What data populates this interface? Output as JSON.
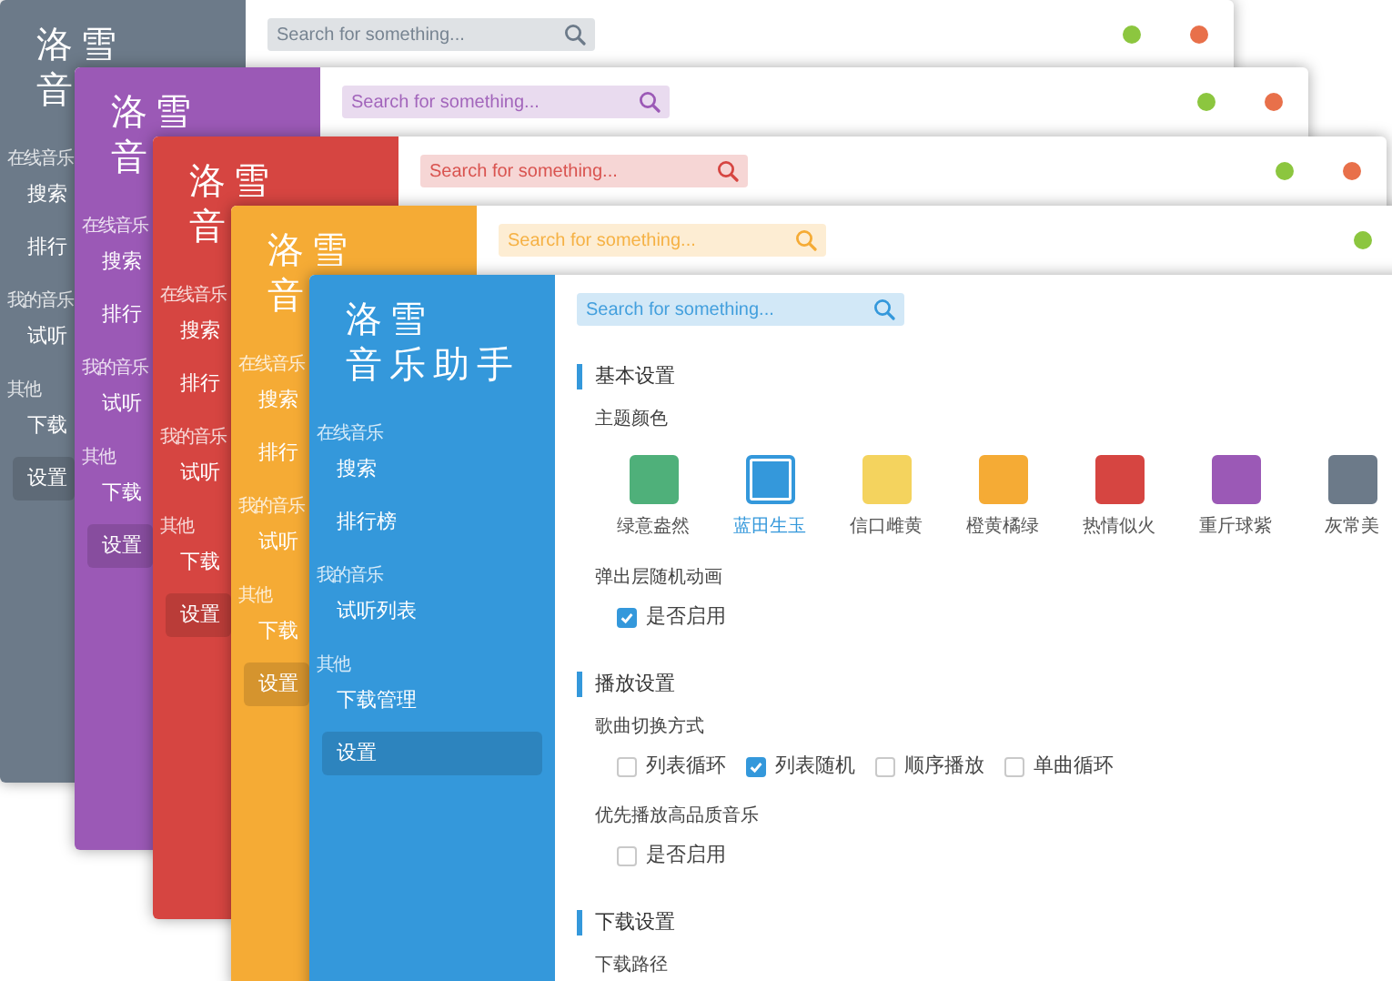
{
  "windows": [
    {
      "color": "#6c7a89",
      "logo": [
        "洛雪",
        "音"
      ],
      "search": {
        "placeholder": "Search for something..."
      },
      "dots": [
        {
          "color": "#8cc63f"
        },
        {
          "color": "#e8704a"
        }
      ],
      "nav": [
        {
          "kind": "label",
          "text": "在线音乐"
        },
        {
          "kind": "item",
          "text": "搜索",
          "selected": false
        },
        {
          "kind": "item",
          "text": "排行",
          "selected": false
        },
        {
          "kind": "label",
          "text": "我的音乐"
        },
        {
          "kind": "item",
          "text": "试听",
          "selected": false
        },
        {
          "kind": "label",
          "text": "其他"
        },
        {
          "kind": "item",
          "text": "下载",
          "selected": false
        },
        {
          "kind": "item",
          "text": "设置",
          "selected": true
        }
      ]
    },
    {
      "color": "#9b59b6",
      "logo": [
        "洛雪",
        "音"
      ],
      "search": {
        "placeholder": "Search for something..."
      },
      "dots": [
        {
          "color": "#8cc63f"
        },
        {
          "color": "#e8704a"
        }
      ],
      "nav": [
        {
          "kind": "label",
          "text": "在线音乐"
        },
        {
          "kind": "item",
          "text": "搜索",
          "selected": false
        },
        {
          "kind": "item",
          "text": "排行",
          "selected": false
        },
        {
          "kind": "label",
          "text": "我的音乐"
        },
        {
          "kind": "item",
          "text": "试听",
          "selected": false
        },
        {
          "kind": "label",
          "text": "其他"
        },
        {
          "kind": "item",
          "text": "下载",
          "selected": false
        },
        {
          "kind": "item",
          "text": "设置",
          "selected": true
        }
      ]
    },
    {
      "color": "#d64541",
      "logo": [
        "洛雪",
        "音"
      ],
      "search": {
        "placeholder": "Search for something..."
      },
      "dots": [
        {
          "color": "#8cc63f"
        },
        {
          "color": "#e8704a"
        }
      ],
      "nav": [
        {
          "kind": "label",
          "text": "在线音乐"
        },
        {
          "kind": "item",
          "text": "搜索",
          "selected": false
        },
        {
          "kind": "item",
          "text": "排行",
          "selected": false
        },
        {
          "kind": "label",
          "text": "我的音乐"
        },
        {
          "kind": "item",
          "text": "试听",
          "selected": false
        },
        {
          "kind": "label",
          "text": "其他"
        },
        {
          "kind": "item",
          "text": "下载",
          "selected": false
        },
        {
          "kind": "item",
          "text": "设置",
          "selected": true
        }
      ]
    },
    {
      "color": "#f5ab35",
      "logo": [
        "洛雪",
        "音"
      ],
      "search": {
        "placeholder": "Search for something..."
      },
      "dots": [
        {
          "color": "#8cc63f"
        }
      ],
      "nav": [
        {
          "kind": "label",
          "text": "在线音乐"
        },
        {
          "kind": "item",
          "text": "搜索",
          "selected": false
        },
        {
          "kind": "item",
          "text": "排行",
          "selected": false
        },
        {
          "kind": "label",
          "text": "我的音乐"
        },
        {
          "kind": "item",
          "text": "试听",
          "selected": false
        },
        {
          "kind": "label",
          "text": "其他"
        },
        {
          "kind": "item",
          "text": "下载",
          "selected": false
        },
        {
          "kind": "item",
          "text": "设置",
          "selected": true
        }
      ]
    },
    {
      "color": "#3498db",
      "logo": [
        "洛雪",
        "音乐助手"
      ],
      "search": {
        "placeholder": "Search for something..."
      },
      "nav": [
        {
          "kind": "label",
          "text": "在线音乐"
        },
        {
          "kind": "item",
          "text": "搜索",
          "selected": false
        },
        {
          "kind": "item",
          "text": "排行榜",
          "selected": false
        },
        {
          "kind": "label",
          "text": "我的音乐"
        },
        {
          "kind": "item",
          "text": "试听列表",
          "selected": false
        },
        {
          "kind": "label",
          "text": "其他"
        },
        {
          "kind": "item",
          "text": "下载管理",
          "selected": false
        },
        {
          "kind": "item",
          "text": "设置",
          "selected": true
        }
      ],
      "settings": [
        {
          "title": "基本设置",
          "groups": [
            {
              "kind": "swatches",
              "label": "主题颜色",
              "options": [
                {
                  "text": "绿意盎然",
                  "color": "#4fb07a",
                  "selected": false
                },
                {
                  "text": "蓝田生玉",
                  "color": "#3498db",
                  "selected": true
                },
                {
                  "text": "信口雌黄",
                  "color": "#f4d35e",
                  "selected": false
                },
                {
                  "text": "橙黄橘绿",
                  "color": "#f5ab35",
                  "selected": false
                },
                {
                  "text": "热情似火",
                  "color": "#d64541",
                  "selected": false
                },
                {
                  "text": "重斤球紫",
                  "color": "#9b59b6",
                  "selected": false
                },
                {
                  "text": "灰常美",
                  "color": "#6c7a89",
                  "selected": false
                }
              ]
            },
            {
              "kind": "checkboxes",
              "label": "弹出层随机动画",
              "options": [
                {
                  "text": "是否启用",
                  "checked": true
                }
              ]
            }
          ]
        },
        {
          "title": "播放设置",
          "groups": [
            {
              "kind": "checkboxes",
              "label": "歌曲切换方式",
              "options": [
                {
                  "text": "列表循环",
                  "checked": false
                },
                {
                  "text": "列表随机",
                  "checked": true
                },
                {
                  "text": "顺序播放",
                  "checked": false
                },
                {
                  "text": "单曲循环",
                  "checked": false
                }
              ]
            },
            {
              "kind": "checkboxes",
              "label": "优先播放高品质音乐",
              "options": [
                {
                  "text": "是否启用",
                  "checked": false
                }
              ]
            }
          ]
        },
        {
          "title": "下载设置",
          "groups": [
            {
              "kind": "label",
              "label": "下载路径"
            }
          ]
        }
      ]
    }
  ]
}
